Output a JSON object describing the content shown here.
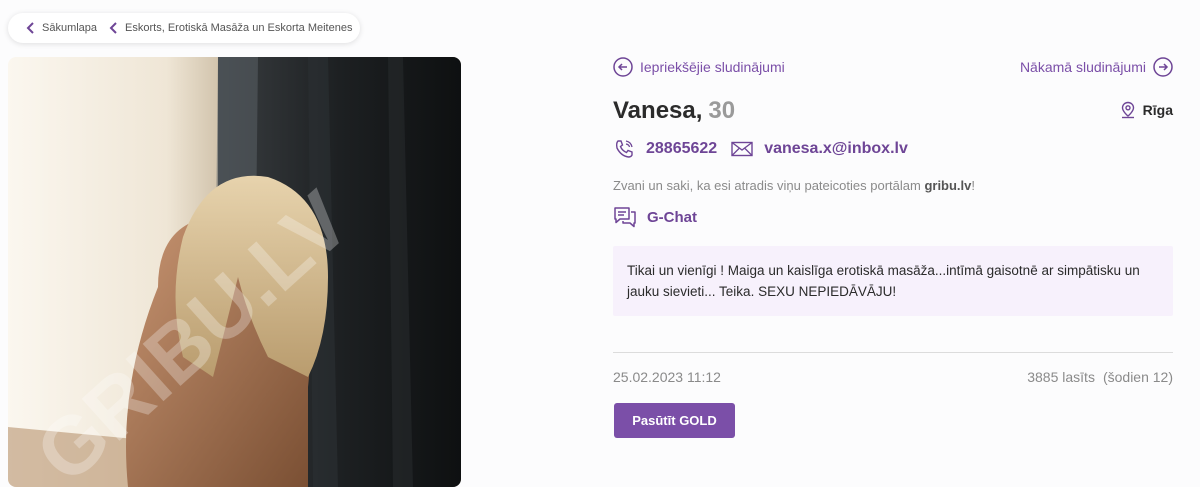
{
  "breadcrumb": [
    {
      "label": "Sākumlapa"
    },
    {
      "label": "Eskorts, Erotiskā Masāža un Eskorta Meitenes"
    }
  ],
  "photo": {
    "watermark": "GRIBU.LV"
  },
  "nav": {
    "prev_label": "Iepriekšējie sludinājumi",
    "next_label": "Nākamā sludinājumi"
  },
  "listing": {
    "name": "Vanesa,",
    "age": "30",
    "city": "Rīga",
    "phone": "28865622",
    "email": "vanesa.x@inbox.lv",
    "hint_prefix": "Zvani un saki, ka esi atradis viņu pateicoties portālam ",
    "hint_brand": "gribu.lv",
    "hint_suffix": "!",
    "gchat_label": "G-Chat",
    "description": "Tikai un vienīgi ! Maiga un kaislīga erotiskā masāža...intīmā gaisotnē ar simpātisku un jauku sievieti... Teika. SEXU NEPIEDĀVĀJU!",
    "date": "25.02.2023 11:12",
    "views": "3885 lasīts",
    "views_today": "(šodien 12)",
    "gold_button": "Pasūtīt GOLD"
  },
  "colors": {
    "accent": "#7b4fa8",
    "accent_text": "#6e4596",
    "desc_bg": "#f7f1fc"
  },
  "icons": [
    "chevron-left-icon",
    "arrow-left-circle-icon",
    "arrow-right-circle-icon",
    "location-pin-icon",
    "phone-icon",
    "mail-icon",
    "chat-icon"
  ]
}
